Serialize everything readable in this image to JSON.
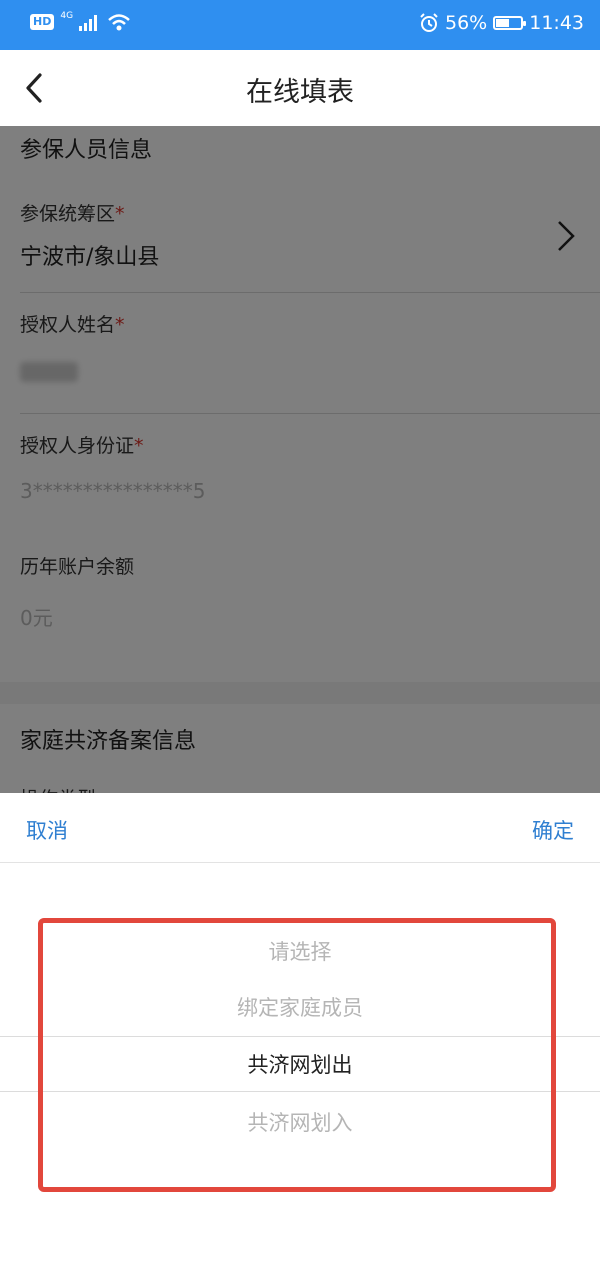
{
  "status_bar": {
    "network_type": "4G",
    "hd_badge": "HD",
    "battery_percent": "56%",
    "battery_level": 0.56,
    "time": "11:43",
    "icons": [
      "hd-icon",
      "signal-icon",
      "wifi-icon",
      "alarm-icon",
      "battery-icon"
    ]
  },
  "nav": {
    "title": "在线填表",
    "back_icon": "chevron-left-icon"
  },
  "form": {
    "section1_title": "参保人员信息",
    "fields": [
      {
        "label": "参保统筹区",
        "required": true,
        "value": "宁波市/象山县"
      },
      {
        "label": "授权人姓名",
        "required": true,
        "value": ""
      },
      {
        "label": "授权人身份证",
        "required": true,
        "value": "3****************5"
      },
      {
        "label": "历年账户余额",
        "required": false,
        "value": "0元"
      }
    ],
    "required_mark": "*",
    "section2_title": "家庭共济备案信息",
    "partial_field_label": "操作类型"
  },
  "picker": {
    "cancel": "取消",
    "confirm": "确定",
    "options": [
      "请选择",
      "绑定家庭成员",
      "共济网划出",
      "共济网划入"
    ],
    "selected_index": 2
  },
  "colors": {
    "status_bar": "#2f8ff0",
    "link_blue": "#2f7fd1",
    "required_red": "#d9322a",
    "highlight_red": "#e2473c"
  }
}
